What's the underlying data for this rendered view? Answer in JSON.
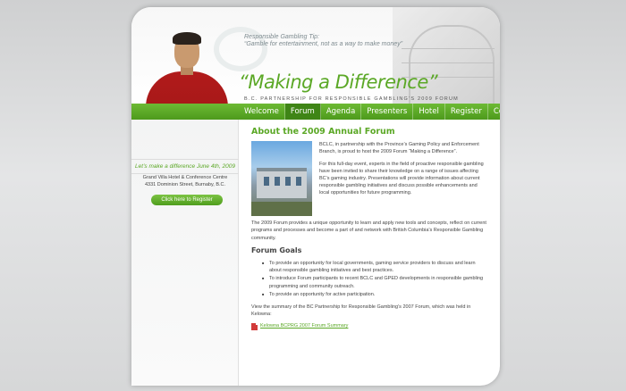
{
  "header": {
    "tip_label": "Responsible Gambling Tip:",
    "tip_text": "“Gamble for entertainment, not as a way to make money”",
    "title": "“Making a Difference”",
    "subtitle": "B.C. PARTNERSHIP FOR RESPONSIBLE GAMBLING’S 2009 FORUM"
  },
  "nav": {
    "items": [
      "Welcome",
      "Forum",
      "Agenda",
      "Presenters",
      "Hotel",
      "Register",
      "Contact"
    ],
    "active_index": 1
  },
  "sidebar": {
    "date_line": "Let’s make a difference June 4th, 2009",
    "venue_line1": "Grand Villa Hotel & Conference Centre",
    "venue_line2": "4331 Dominion Street, Burnaby, B.C.",
    "register_label": "Click here to Register"
  },
  "main": {
    "heading": "About the 2009 Annual Forum",
    "para1": "BCLC, in partnership with the Province’s Gaming Policy and Enforcement Branch, is proud to host the 2009 Forum “Making a Difference”.",
    "para2": "For this full-day event, experts in the field of proactive responsible gambling have been invited to share their knowledge on a range of issues affecting BC’s gaming industry. Presentations will provide information about current responsible gambling initiatives and discuss possible enhancements and local opportunities for future programming.",
    "para3": "The 2009 Forum provides a unique opportunity to learn and apply new tools and concepts, reflect on current programs and processes and become a part of and network with British Columbia’s Responsible Gambling community.",
    "goals_heading": "Forum Goals",
    "goals": [
      "To provide an opportunity for local governments, gaming service providers to discuss and learn about responsible gambling initiatives and best practices.",
      "To introduce Forum participants to recent BCLC and GPED developments in responsible gambling programming and community outreach.",
      "To provide an opportunity for active participation."
    ],
    "summary_text": "View the summary of the BC Partnership for Responsible Gambling’s 2007 Forum, which was held in Kelowna:",
    "pdf_link": "Kelowna BCPRG 2007 Forum Summary"
  },
  "colors": {
    "accent_green": "#5ba826",
    "nav_green": "#4d9a1c",
    "shirt_red": "#b11b1b"
  }
}
